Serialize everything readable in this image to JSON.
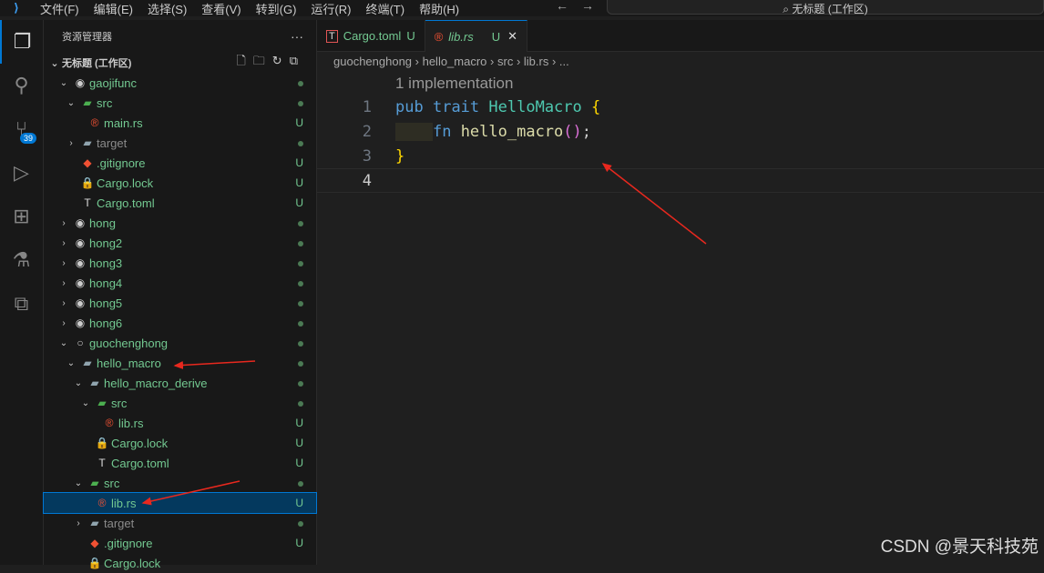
{
  "titlebar": {
    "menus": [
      "文件(F)",
      "编辑(E)",
      "选择(S)",
      "查看(V)",
      "转到(G)",
      "运行(R)",
      "终端(T)",
      "帮助(H)"
    ],
    "search": "无标题 (工作区)"
  },
  "activity": {
    "scm_badge": "39"
  },
  "sidebar": {
    "title": "资源管理器",
    "more": "···",
    "workspace": "无标题 (工作区)",
    "rows": [
      {
        "label": "gaojifunc",
        "level": 0,
        "chev": "down",
        "icon": "repo",
        "status": "dot"
      },
      {
        "label": "src",
        "level": 1,
        "chev": "down",
        "icon": "folder-src",
        "status": "dot"
      },
      {
        "label": "main.rs",
        "level": 2,
        "icon": "rust",
        "status": "U"
      },
      {
        "label": "target",
        "level": 1,
        "chev": "right",
        "icon": "folder",
        "status": "dot",
        "gray": true
      },
      {
        "label": ".gitignore",
        "level": 1,
        "icon": "git",
        "status": "U"
      },
      {
        "label": "Cargo.lock",
        "level": 1,
        "icon": "lock",
        "status": "U"
      },
      {
        "label": "Cargo.toml",
        "level": 1,
        "icon": "toml",
        "status": "U"
      },
      {
        "label": "hong",
        "level": 0,
        "chev": "right",
        "icon": "repo",
        "status": "dot"
      },
      {
        "label": "hong2",
        "level": 0,
        "chev": "right",
        "icon": "repo",
        "status": "dot"
      },
      {
        "label": "hong3",
        "level": 0,
        "chev": "right",
        "icon": "repo",
        "status": "dot"
      },
      {
        "label": "hong4",
        "level": 0,
        "chev": "right",
        "icon": "repo",
        "status": "dot"
      },
      {
        "label": "hong5",
        "level": 0,
        "chev": "right",
        "icon": "repo",
        "status": "dot"
      },
      {
        "label": "hong6",
        "level": 0,
        "chev": "right",
        "icon": "repo",
        "status": "dot"
      },
      {
        "label": "guochenghong",
        "level": 0,
        "chev": "down",
        "icon": "repo-open",
        "status": "dot"
      },
      {
        "label": "hello_macro",
        "level": 1,
        "chev": "down",
        "icon": "folder",
        "status": "dot"
      },
      {
        "label": "hello_macro_derive",
        "level": 2,
        "chev": "down",
        "icon": "folder",
        "status": "dot"
      },
      {
        "label": "src",
        "level": 3,
        "chev": "down",
        "icon": "folder-src",
        "status": "dot"
      },
      {
        "label": "lib.rs",
        "level": 4,
        "icon": "rust",
        "status": "U"
      },
      {
        "label": "Cargo.lock",
        "level": 3,
        "icon": "lock",
        "status": "U"
      },
      {
        "label": "Cargo.toml",
        "level": 3,
        "icon": "toml",
        "status": "U"
      },
      {
        "label": "src",
        "level": 2,
        "chev": "down",
        "icon": "folder-src",
        "status": "dot"
      },
      {
        "label": "lib.rs",
        "level": 3,
        "icon": "rust",
        "status": "U",
        "selected": true
      },
      {
        "label": "target",
        "level": 2,
        "chev": "right",
        "icon": "folder",
        "status": "dot",
        "gray": true
      },
      {
        "label": ".gitignore",
        "level": 2,
        "icon": "git",
        "status": "U"
      },
      {
        "label": "Cargo.lock",
        "level": 2,
        "icon": "lock",
        "status": ""
      }
    ]
  },
  "tabs": [
    {
      "label": "Cargo.toml",
      "status": "U",
      "icon": "toml"
    },
    {
      "label": "lib.rs",
      "status": "U",
      "icon": "rust",
      "active": true
    }
  ],
  "breadcrumb": [
    "guochenghong",
    "hello_macro",
    "src",
    "lib.rs",
    "..."
  ],
  "editor": {
    "codelens": "1 implementation",
    "lines": [
      "1",
      "2",
      "3",
      "4"
    ],
    "l1": {
      "a": "pub",
      "b": "trait",
      "c": "HelloMacro",
      "d": "{"
    },
    "l2": {
      "a": "fn",
      "b": "hello_macro",
      "c": "()",
      "d": ";"
    },
    "l3": "}"
  },
  "watermark": "CSDN @景天科技苑",
  "colors": {
    "accent": "#0078d4",
    "untracked": "#73c991",
    "arrow": "#e8281e"
  }
}
